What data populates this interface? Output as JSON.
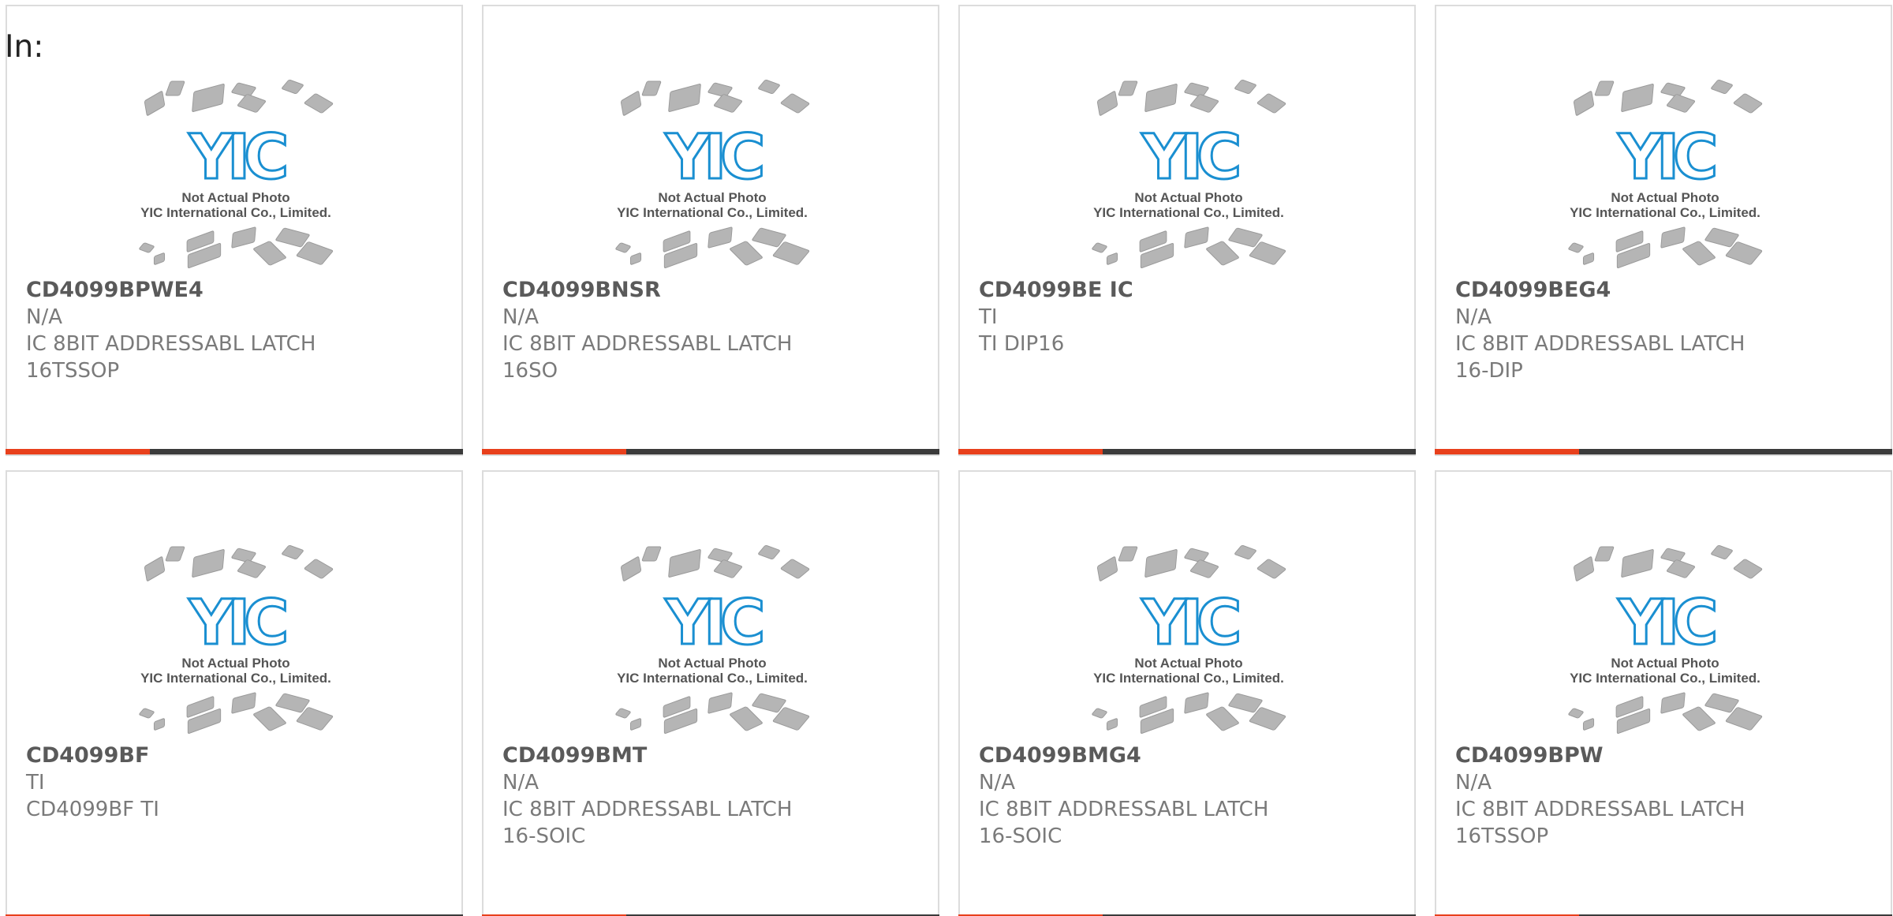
{
  "header": {
    "in_label": "In:"
  },
  "placeholder_image": {
    "logo_text": "YIC",
    "line1": "Not Actual Photo",
    "line2": "YIC International Co., Limited."
  },
  "colors": {
    "accent": "#e8401c",
    "bar_dark": "#3b3b3b",
    "logo_blue": "#1a8fd1",
    "chip_gray": "#b5b5b5"
  },
  "products": [
    {
      "part": "CD4099BPWE4",
      "mfr": "N/A",
      "desc": "IC 8BIT ADDRESSABL LATCH 16TSSOP"
    },
    {
      "part": "CD4099BNSR",
      "mfr": "N/A",
      "desc": "IC 8BIT ADDRESSABL LATCH 16SO"
    },
    {
      "part": "CD4099BE IC",
      "mfr": "TI",
      "desc": "TI DIP16"
    },
    {
      "part": "CD4099BEG4",
      "mfr": "N/A",
      "desc": "IC 8BIT ADDRESSABL LATCH 16-DIP"
    },
    {
      "part": "CD4099BF",
      "mfr": "TI",
      "desc": "CD4099BF TI"
    },
    {
      "part": "CD4099BMT",
      "mfr": "N/A",
      "desc": "IC 8BIT ADDRESSABL LATCH 16-SOIC"
    },
    {
      "part": "CD4099BMG4",
      "mfr": "N/A",
      "desc": "IC 8BIT ADDRESSABL LATCH 16-SOIC"
    },
    {
      "part": "CD4099BPW",
      "mfr": "N/A",
      "desc": "IC 8BIT ADDRESSABL LATCH 16TSSOP"
    }
  ]
}
